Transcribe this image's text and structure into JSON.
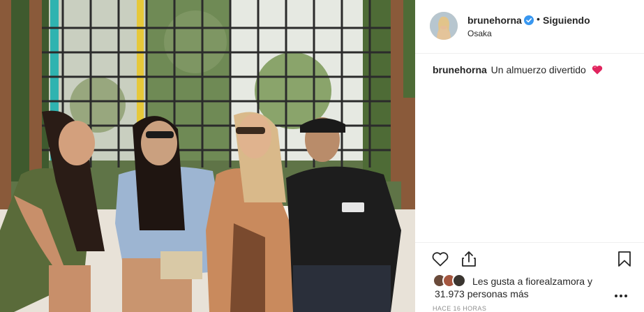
{
  "post": {
    "author": {
      "username": "brunehorna",
      "verified": true,
      "separator": "•",
      "follow_state": "Siguiendo",
      "location": "Osaka"
    },
    "caption": {
      "username": "brunehorna",
      "text": "Un almuerzo divertido",
      "emoji": "heart-emoji"
    },
    "actions": {
      "like_icon": "heart-icon",
      "share_icon": "share-icon",
      "save_icon": "bookmark-icon"
    },
    "likes": {
      "prefix": "Les gusta a",
      "first_liker": "fiorealzamora",
      "conjunction": "y",
      "others": "31.973 personas más"
    },
    "timestamp": "HACE 16 HORAS"
  },
  "colors": {
    "text": "#262626",
    "muted": "#8e8e8e",
    "verified_blue": "#3897f0",
    "divider": "#efefef",
    "heart_red": "#e0245e"
  }
}
